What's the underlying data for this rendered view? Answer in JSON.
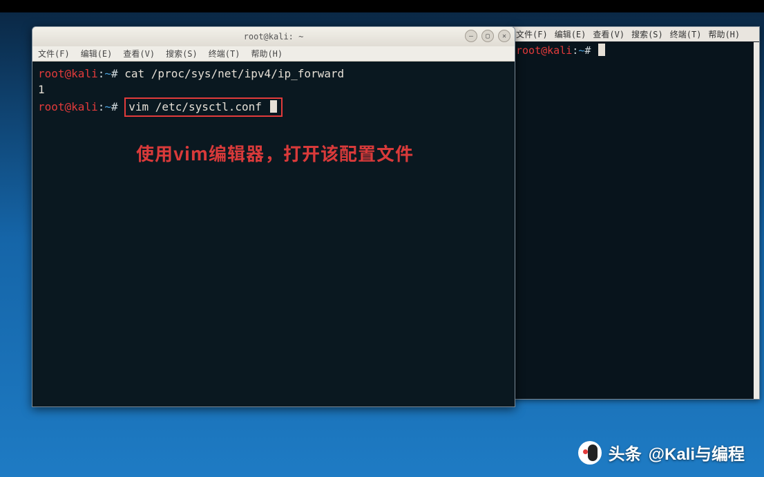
{
  "top_panel": {},
  "window_back": {
    "menubar": [
      "文件(F)",
      "编辑(E)",
      "查看(V)",
      "搜索(S)",
      "终端(T)",
      "帮助(H)"
    ],
    "prompt": {
      "user": "root",
      "at": "@",
      "host": "kali",
      "sep": ":",
      "path": "~",
      "symbol": "#"
    }
  },
  "window_front": {
    "title": "root@kali: ~",
    "controls": {
      "minimize_icon": "–",
      "maximize_icon": "▢",
      "close_icon": "✕"
    },
    "menubar": [
      "文件(F)",
      "编辑(E)",
      "查看(V)",
      "搜索(S)",
      "终端(T)",
      "帮助(H)"
    ],
    "prompt": {
      "user": "root",
      "at": "@",
      "host": "kali",
      "sep": ":",
      "path": "~",
      "symbol": "#"
    },
    "lines": {
      "cmd1": "cat /proc/sys/net/ipv4/ip_forward",
      "out1": "1",
      "cmd2": "vim /etc/sysctl.conf"
    },
    "annotation": "使用vim编辑器，打开该配置文件"
  },
  "watermark": {
    "label": "头条",
    "handle": "@Kali与编程"
  },
  "colors": {
    "prompt_user": "#e33b3b",
    "prompt_path": "#4aa3df",
    "terminal_bg": "#0a1820",
    "highlight_box": "#e33b3b",
    "annotation": "#d83a3a"
  }
}
